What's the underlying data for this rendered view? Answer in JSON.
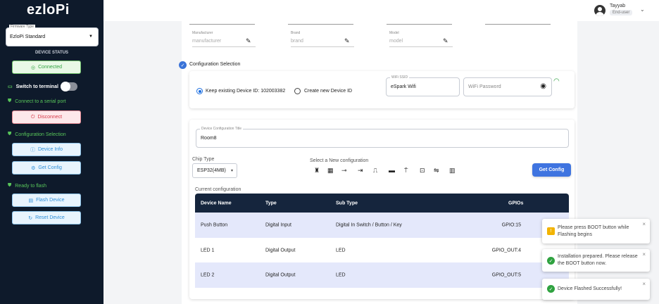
{
  "app": {
    "logo": "ezloPi"
  },
  "sidebar": {
    "firmware_label": "Firmware Type",
    "firmware_value": "EzloPi Standard",
    "device_status_label": "DEVICE STATUS",
    "connected_label": "Connected",
    "switch_terminal_label": "Switch to terminal",
    "connect_serial_label": "Connect to a serial port",
    "disconnect_label": "Disconnect",
    "config_selection_label": "Configuration Selection",
    "device_info_label": "Device Info",
    "get_config_label": "Get Config",
    "ready_flash_label": "Ready to flash",
    "flash_device_label": "Flash Device",
    "reset_device_label": "Reset Device"
  },
  "header": {
    "user_name": "Tayyab",
    "user_role": "End-user"
  },
  "device_fields": [
    {
      "label": "Manufacturer",
      "placeholder": "manufacturer"
    },
    {
      "label": "Brand",
      "placeholder": "brand"
    },
    {
      "label": "Model",
      "placeholder": "model"
    }
  ],
  "config_selection": {
    "title": "Configuration Selection",
    "keep_existing_label": "Keep existing Device ID: 102003382",
    "create_new_label": "Create new Device ID",
    "wifi_ssid_label": "WiFi SSID",
    "wifi_ssid_value": "eSpark Wifi",
    "wifi_password_placeholder": "WiFi Password"
  },
  "device_config": {
    "title_label": "Device Configuration Title",
    "title_value": "Room8",
    "chip_type_label": "Chip Type",
    "chip_type_value": "ESP32(4MB)",
    "select_new_label": "Select a New configuration",
    "get_config_button": "Get Config",
    "current_config_label": "Current configuration",
    "table_headers": [
      "Device Name",
      "Type",
      "Sub Type",
      "GPIOs"
    ],
    "rows": [
      {
        "name": "Push Button",
        "type": "Digital Input",
        "subtype": "Digital In Switch / Button / Key",
        "gpio": "GPIO:15"
      },
      {
        "name": "LED 1",
        "type": "Digital Output",
        "subtype": "LED",
        "gpio": "GPIO_OUT:4"
      },
      {
        "name": "LED 2",
        "type": "Digital Output",
        "subtype": "LED",
        "gpio": "GPIO_OUT:5"
      }
    ]
  },
  "toasts": [
    {
      "type": "warning",
      "message": "Please press BOOT button while Flashing begins"
    },
    {
      "type": "success",
      "message": "Installation prepared. Please release the BOOT button now."
    },
    {
      "type": "success",
      "message": "Device Flashed Successfully!"
    }
  ],
  "colors": {
    "sidebar_bg": "#0e1a2b",
    "accent_blue": "#3f74e0",
    "success": "#2fa240",
    "warning": "#f2b300",
    "danger": "#d63848"
  }
}
